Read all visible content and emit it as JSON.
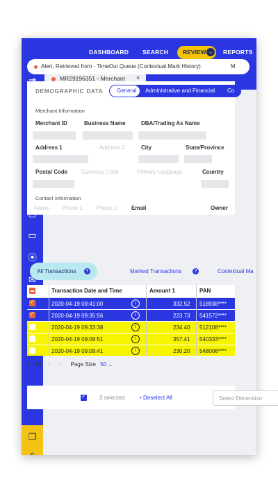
{
  "nav": {
    "dashboard": "DASHBOARD",
    "search": "SEARCH",
    "review": "REVIEW",
    "reports": "REPORTS"
  },
  "tab": {
    "label": "MR29196351 - Merchant",
    "close": "×"
  },
  "alert": {
    "text": "Alert, Retrieved from - TimeOut Queue (Contextual Mark History)",
    "more": "M"
  },
  "demographic": {
    "title": "DEMOGRAPHIC DATA",
    "tabs": [
      "General",
      "Administrative and Financial",
      "Co"
    ],
    "merchant_info": "Merchant Information",
    "fields_row1": [
      "Merchant ID",
      "Business Name",
      "DBA/Trading As Name"
    ],
    "fields_row2": [
      "Address 1",
      "Address 2",
      "City",
      "State/Province"
    ],
    "fields_row3": [
      "Postal Code",
      "Currency Code",
      "Primary Language",
      "Country"
    ],
    "contact_info": "Contact Information",
    "fields_row4": [
      "Name",
      "Phone 1",
      "Phone 2",
      "Email",
      "Owner"
    ]
  },
  "tx_tabs": [
    "All Transactions",
    "Marked Transactions",
    "Contextual Ma"
  ],
  "table": {
    "headers": [
      "Transaction Date and Time",
      "Amount 1",
      "PAN"
    ],
    "rows": [
      {
        "date": "2020-04-19 09:41:00",
        "amount": "332.52",
        "pan": "518938****",
        "state": "sel"
      },
      {
        "date": "2020-04-19 09:35:56",
        "amount": "223.73",
        "pan": "541572****",
        "state": "sel"
      },
      {
        "date": "2020-04-19 09:33:38",
        "amount": "234.40",
        "pan": "512108****",
        "state": "hl"
      },
      {
        "date": "2020-04-19 09:09:51",
        "amount": "357.41",
        "pan": "540333****",
        "state": "hl"
      },
      {
        "date": "2020-04-19 09:09:41",
        "amount": "230.20",
        "pan": "548006****",
        "state": "hl"
      }
    ]
  },
  "pager": {
    "range": "1 - 14",
    "prev": "‹",
    "next": "›",
    "page_size_label": "Page Size",
    "page_size": "50"
  },
  "selection": {
    "count_text": "3 selected",
    "deselect": "Deselect All",
    "dimension_placeholder": "Select Dimension"
  },
  "colors": {
    "primary": "#2a37e0",
    "accent": "#f3c400",
    "highlight": "#f7f400",
    "alert": "#e8643c"
  }
}
